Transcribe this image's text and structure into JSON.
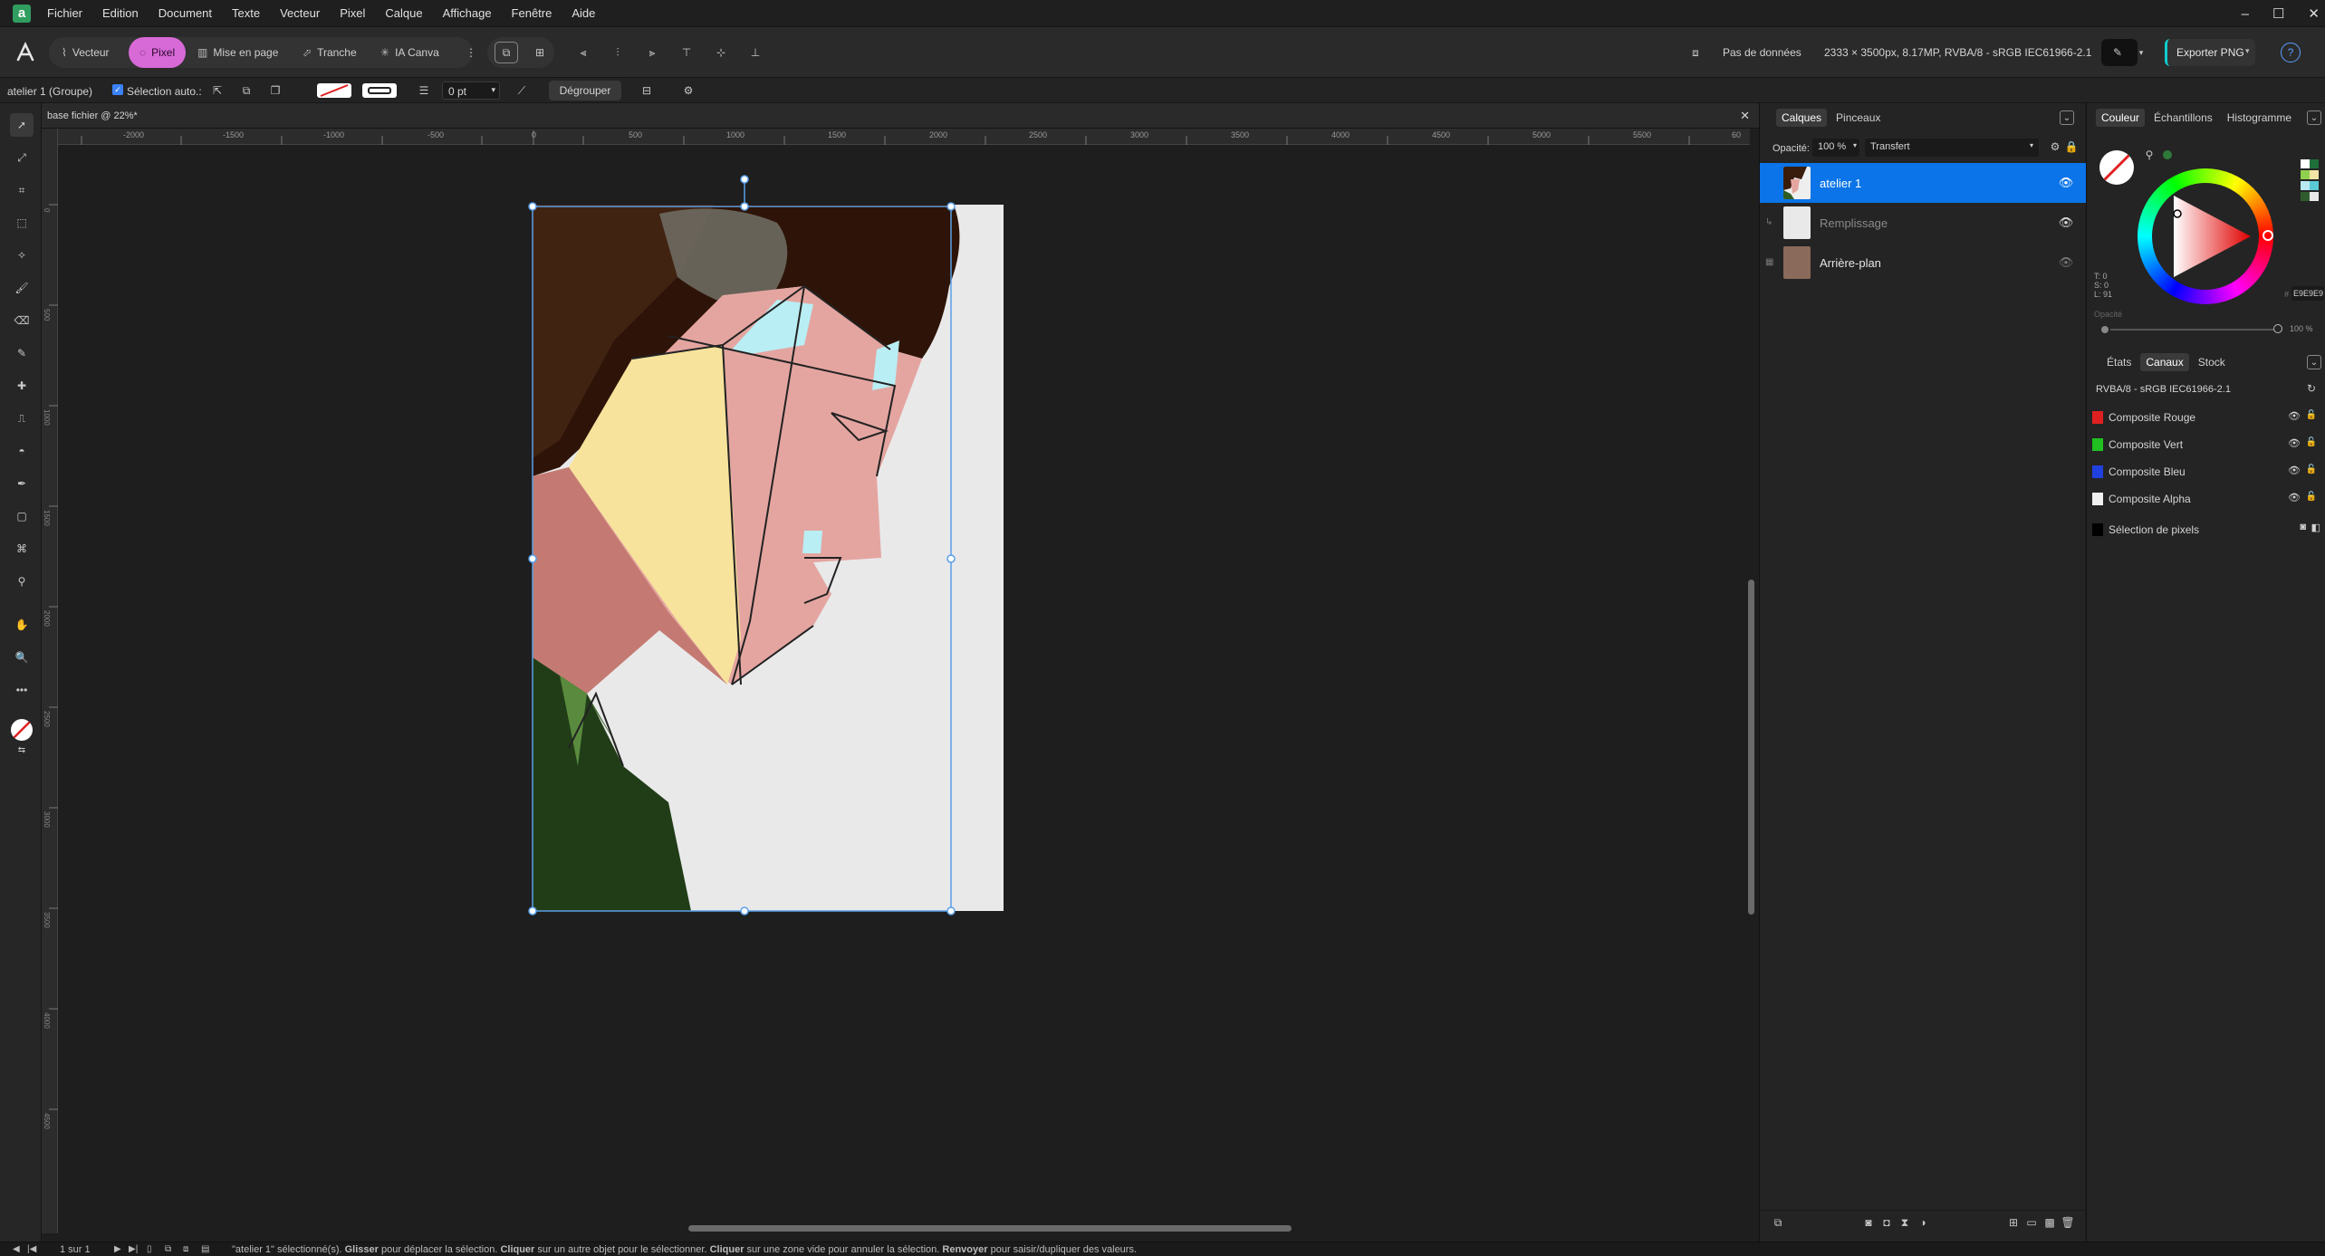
{
  "menubar": {
    "items": [
      "Fichier",
      "Edition",
      "Document",
      "Texte",
      "Vecteur",
      "Pixel",
      "Calque",
      "Affichage",
      "Fenêtre",
      "Aide"
    ]
  },
  "window": {
    "minimize": "–",
    "maximize": "☐",
    "close": "✕"
  },
  "toolbar": {
    "personas": [
      "Vecteur",
      "Pixel",
      "Mise en page",
      "Tranche",
      "IA Canva"
    ],
    "no_data": "Pas de données",
    "doc_info": "2333 × 3500px, 8.17MP, RVBA/8 - sRGB IEC61966-2.1",
    "export": "Exporter PNG",
    "help": "?"
  },
  "context": {
    "selection": "atelier 1 (Groupe)",
    "auto_select": "Sélection auto.:",
    "stroke_width": "0 pt",
    "ungroup": "Dégrouper"
  },
  "document": {
    "tab": "base fichier @ 22%*",
    "ruler_h": [
      "-2000",
      "-1500",
      "-1000",
      "-500",
      "0",
      "500",
      "1000",
      "1500",
      "2000",
      "2500",
      "3000",
      "3500",
      "4000",
      "4500",
      "5000",
      "5500",
      "60"
    ],
    "ruler_v": [
      "0",
      "500",
      "1000",
      "1500",
      "2000",
      "2500",
      "3000",
      "3500",
      "4000",
      "4500"
    ]
  },
  "layers": {
    "tabs": [
      "Calques",
      "Pinceaux"
    ],
    "opacity_label": "Opacité:",
    "opacity_value": "100 %",
    "blend_mode": "Transfert",
    "items": [
      {
        "name": "atelier 1",
        "selected": true
      },
      {
        "name": "Remplissage",
        "selected": false
      },
      {
        "name": "Arrière-plan",
        "selected": false
      }
    ]
  },
  "color": {
    "tabs": [
      "Couleur",
      "Échantillons",
      "Histogramme"
    ],
    "hsl": [
      "T: 0",
      "S: 0",
      "L: 91"
    ],
    "hex": "E9E9E9",
    "opacity_label": "Opacité",
    "opacity_value": "100 %",
    "swatch_colors": [
      "#ffffff",
      "#1f6f3a",
      "#8fd14f",
      "#f3e6a5",
      "#b9e9f2",
      "#5bc8d6",
      "#2f5c2f",
      "#e8e8e8"
    ]
  },
  "channels": {
    "tabs": [
      "États",
      "Canaux",
      "Stock"
    ],
    "profile": "RVBA/8 - sRGB IEC61966-2.1",
    "items": [
      {
        "name": "Composite Rouge",
        "color": "#e02020"
      },
      {
        "name": "Composite Vert",
        "color": "#20c020"
      },
      {
        "name": "Composite Bleu",
        "color": "#2040e0"
      },
      {
        "name": "Composite Alpha",
        "color": "#f0f0f0"
      }
    ],
    "pixel_selection": "Sélection de pixels"
  },
  "status": {
    "page": "1 sur 1",
    "hint_1": "\"atelier 1\" sélectionné(s). ",
    "hint_b1": "Glisser",
    "hint_2": " pour déplacer la sélection. ",
    "hint_b2": "Cliquer",
    "hint_3": " sur un autre objet pour le sélectionner. ",
    "hint_b3": "Cliquer",
    "hint_4": " sur une zone vide pour annuler la sélection. ",
    "hint_b4": "Renvoyer",
    "hint_5": " pour saisir/dupliquer des valeurs."
  }
}
